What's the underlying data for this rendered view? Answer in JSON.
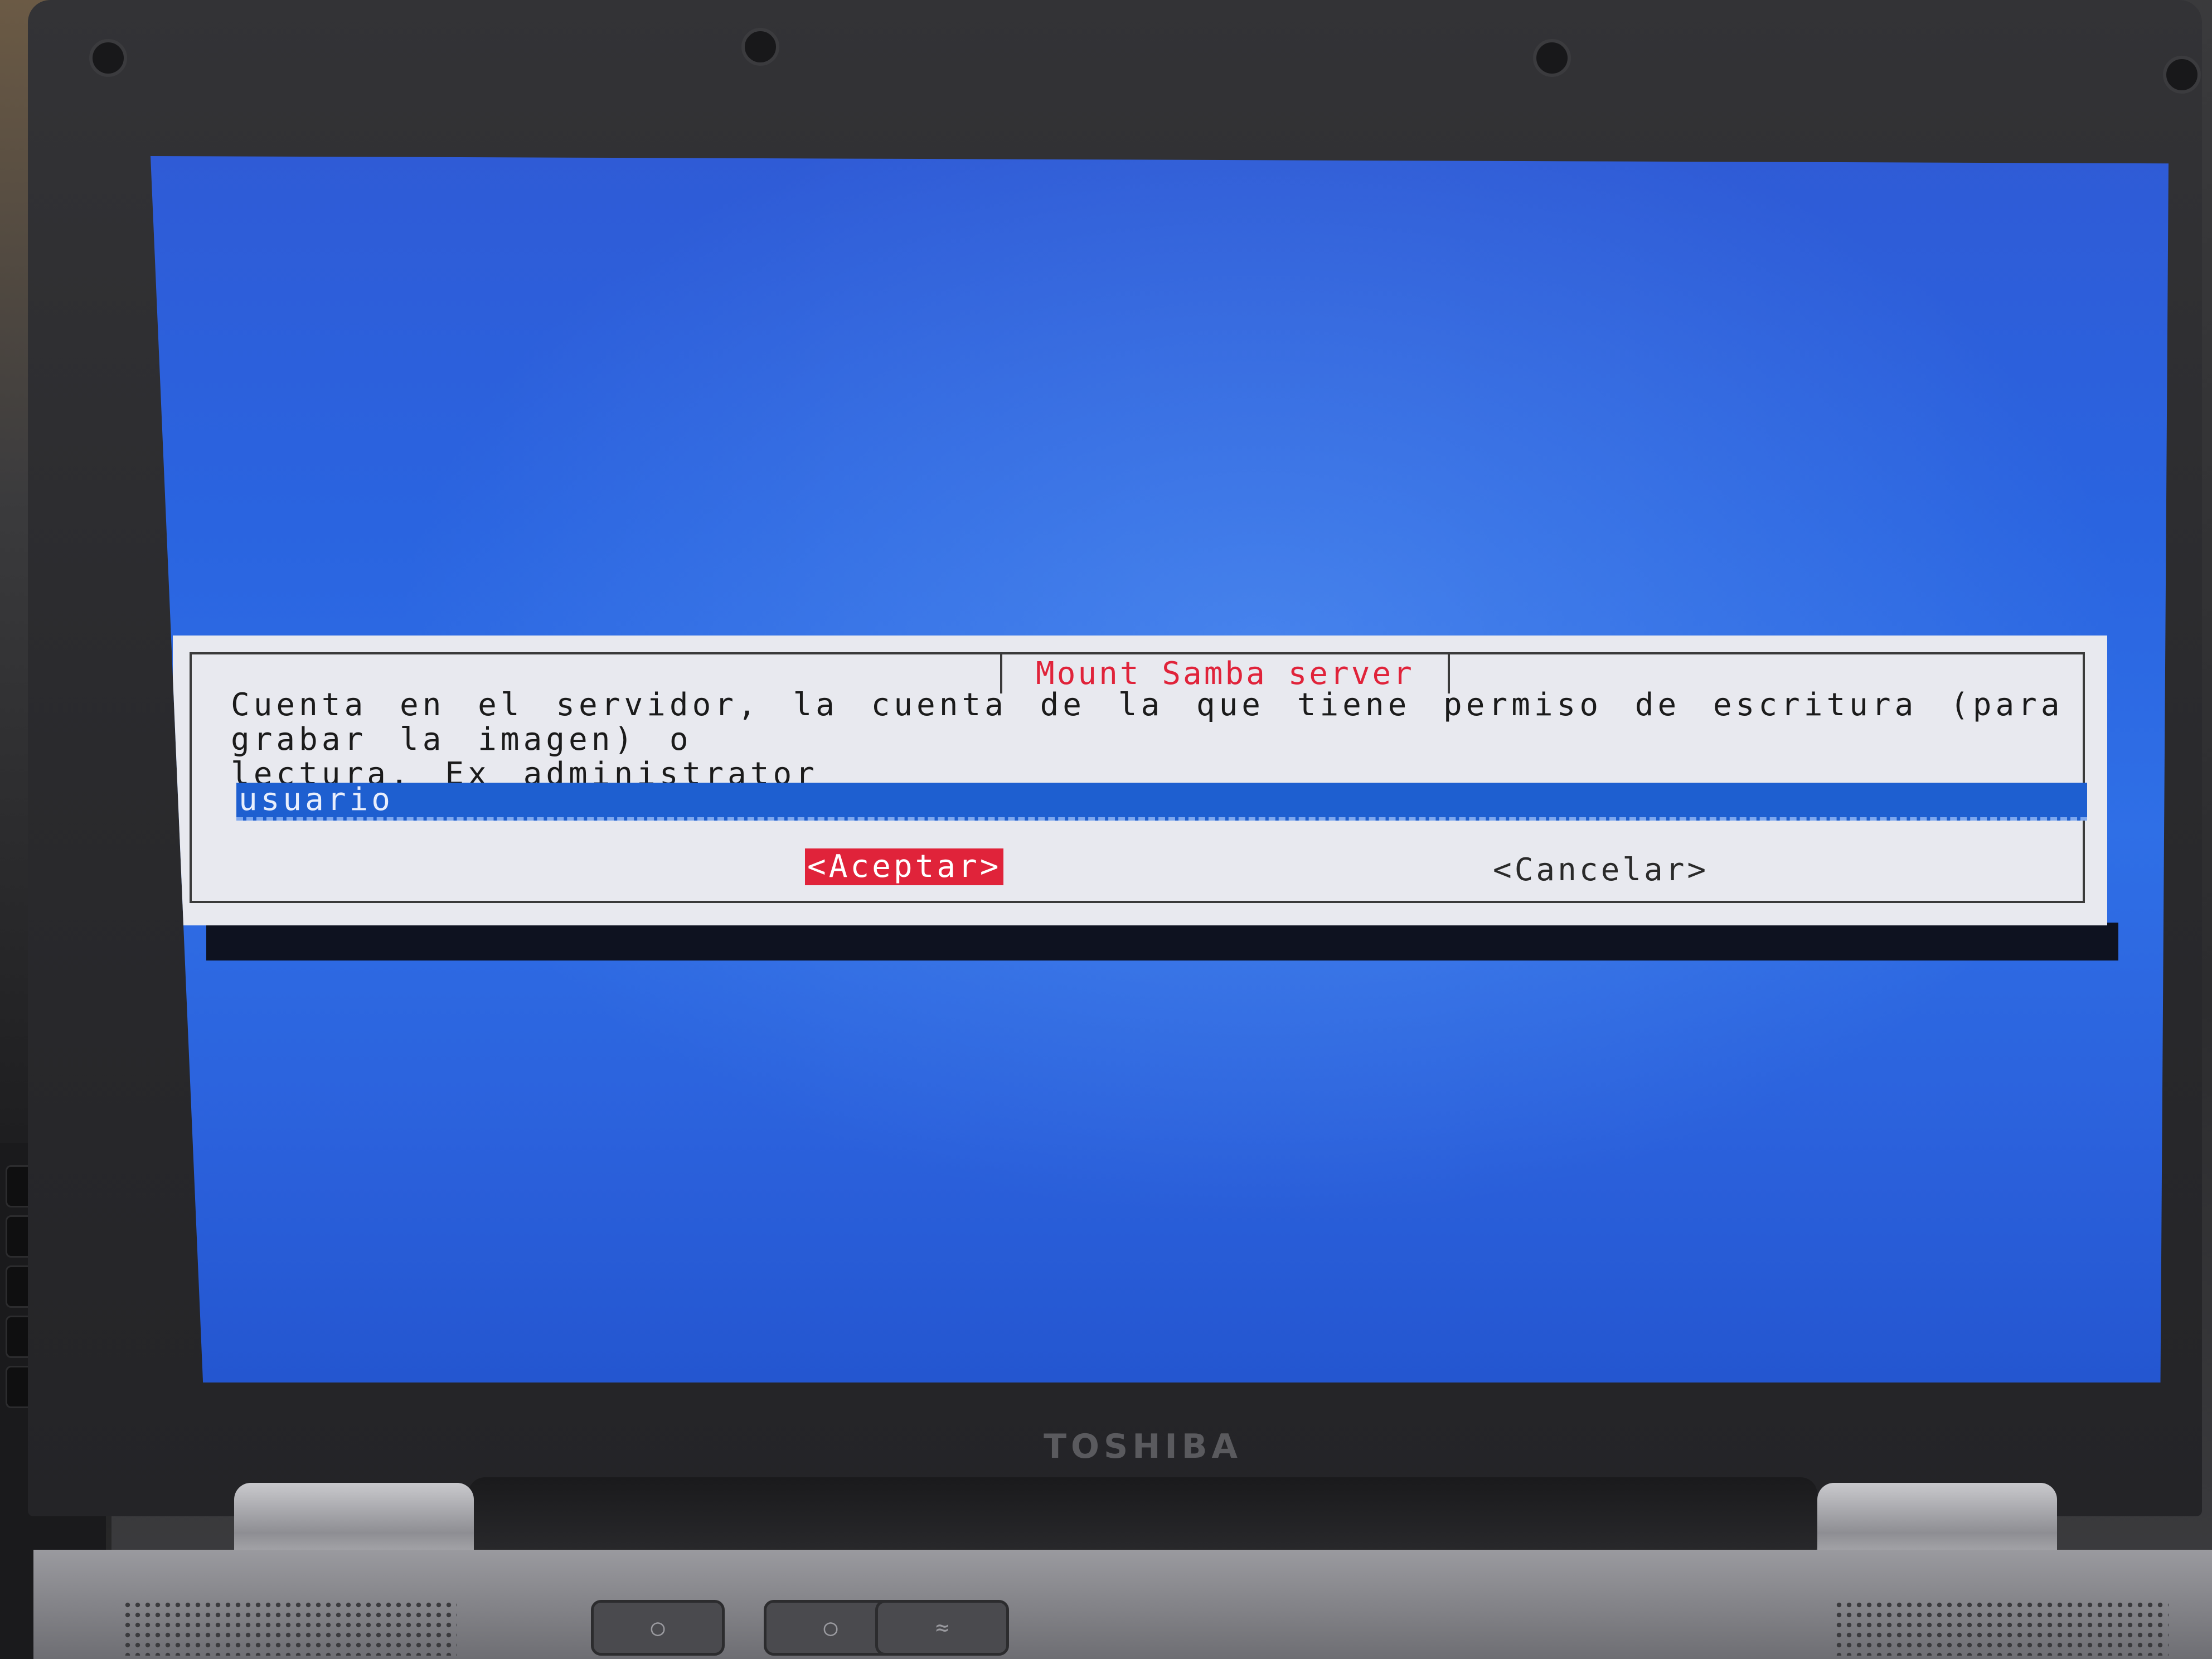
{
  "dialog": {
    "title": "Mount Samba server",
    "prompt": "Cuenta en el servidor, la cuenta de la que tiene permiso de escritura (para grabar la imagen) o\nlectura, Ex administrator",
    "input_value": "usuario",
    "accept_label": "<Aceptar>",
    "cancel_label": "<Cancelar>"
  },
  "brand": "TOSHIBA",
  "colors": {
    "screen_background": "#2a64e0",
    "dialog_background": "#e8e9ef",
    "title_text": "#e0233a",
    "focused_button": "#e0233a",
    "input_background": "#1e5fd0"
  }
}
